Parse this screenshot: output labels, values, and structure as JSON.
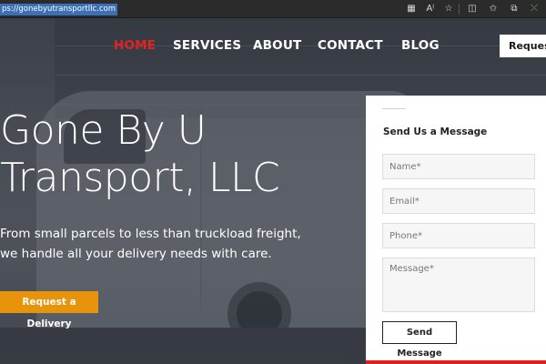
{
  "browser": {
    "url": "ps://gonebyutransportllc.com",
    "toolbar_icons": [
      "qr-code-icon",
      "read-aloud-icon",
      "favorite-star-icon",
      "split-screen-icon",
      "favorites-icon",
      "collections-icon",
      "extension-icon"
    ]
  },
  "nav": {
    "items": [
      {
        "label": "HOME",
        "active": true
      },
      {
        "label": "SERVICES",
        "active": false
      },
      {
        "label": "ABOUT",
        "active": false
      },
      {
        "label": "CONTACT",
        "active": false
      },
      {
        "label": "BLOG",
        "active": false
      }
    ],
    "cta_label": "Request"
  },
  "hero": {
    "title_line1": "Gone By U",
    "title_line2": "Transport, LLC",
    "subtitle_line1": "From small parcels to less than truckload freight,",
    "subtitle_line2": "we handle all your delivery needs with care.",
    "cta_label": "Request a Delivery"
  },
  "form": {
    "title": "Send Us a Message",
    "name_placeholder": "Name*",
    "email_placeholder": "Email*",
    "phone_placeholder": "Phone*",
    "message_placeholder": "Message*",
    "submit_label": "Send Message"
  },
  "colors": {
    "accent_red": "#e32222",
    "accent_orange": "#e8930c",
    "url_highlight": "#3b6fb6"
  }
}
